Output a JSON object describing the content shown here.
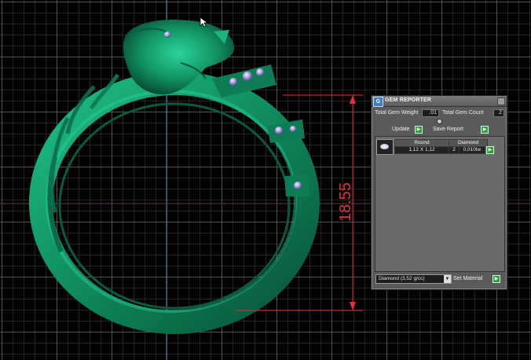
{
  "viewport": {
    "dimension_label": "18.55",
    "colors": {
      "grid": "#78787f",
      "ring": "#159a6b",
      "dimension": "#e0303a",
      "axis": "#3d7fb0"
    }
  },
  "gem_reporter": {
    "title": "GEM REPORTER",
    "logo_icon": "gem-reporter-logo-icon",
    "total_gem_weight_label": "Total Gem Weight",
    "total_gem_weight_value": ".01",
    "total_gem_count_label": "Total Gem Count",
    "total_gem_count_value": "2",
    "update_label": "Update",
    "save_report_label": "Save Report",
    "gem_rows": [
      {
        "shape": "Round",
        "size": "1,12 X 1,12",
        "material": "Diamond",
        "count": "2",
        "weight": "0,010tw"
      }
    ],
    "material_select_value": "Diamond   (3,52 g/cc)",
    "set_material_label": "Set Material"
  }
}
